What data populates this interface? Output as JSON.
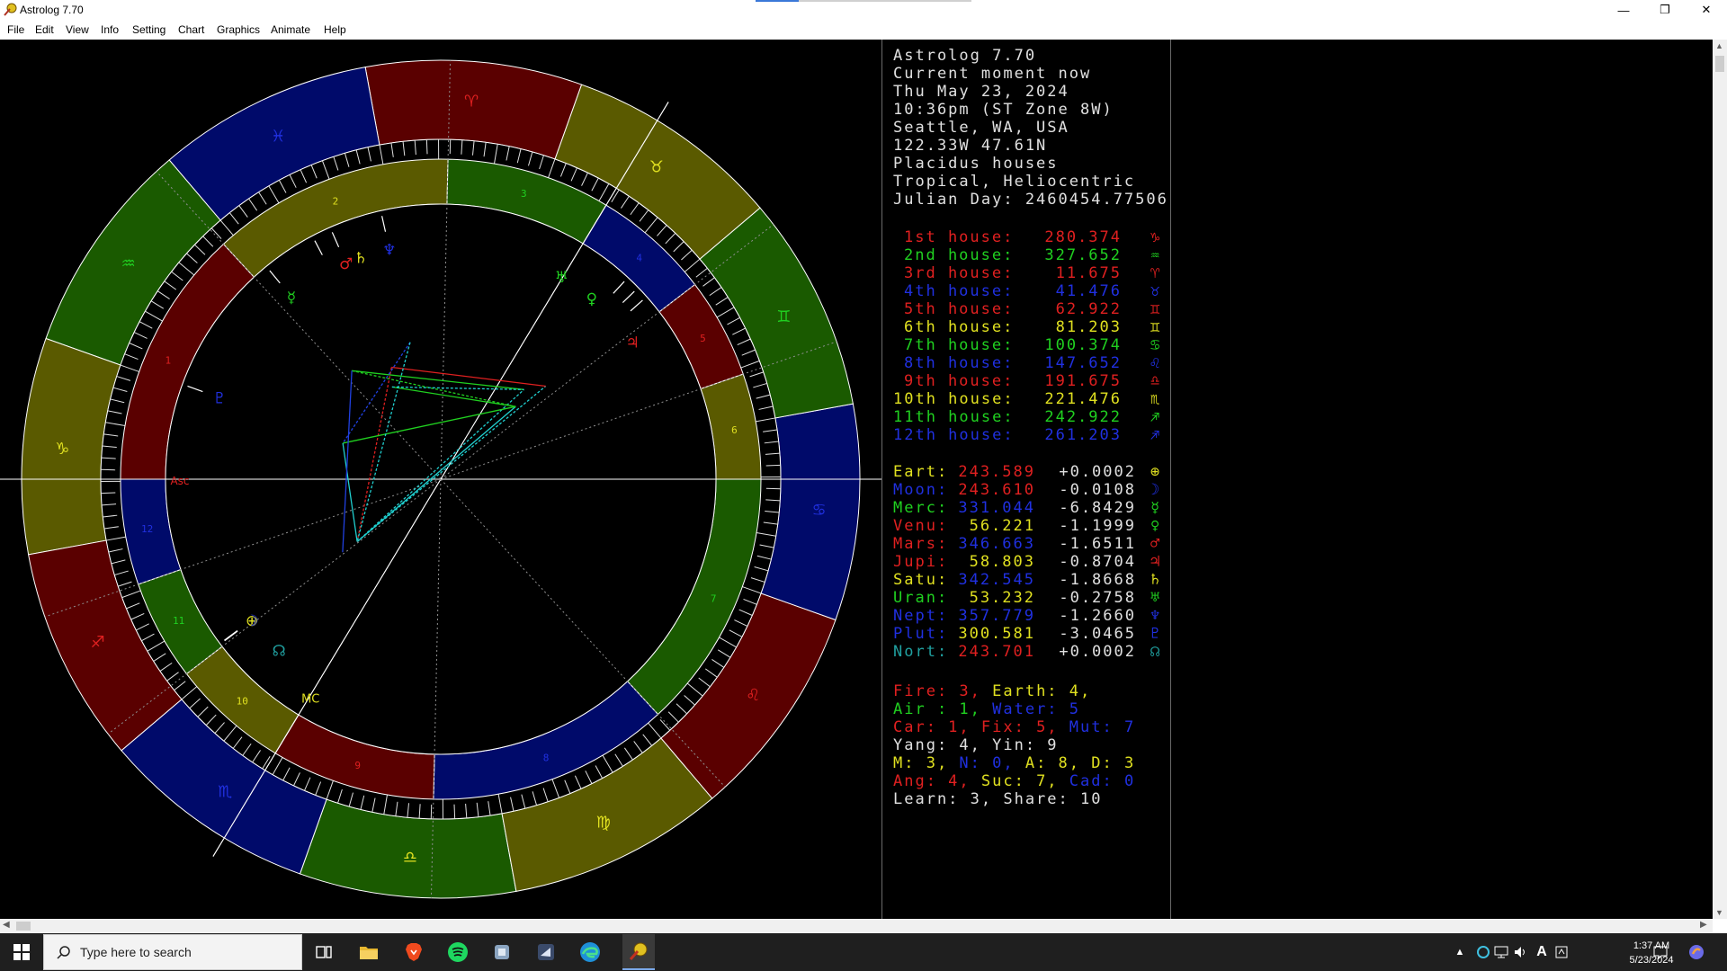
{
  "window": {
    "title": "Astrolog 7.70"
  },
  "menu": [
    "File",
    "Edit",
    "View",
    "Info",
    "Setting",
    "Chart",
    "Graphics",
    "Animate",
    "Help"
  ],
  "info": {
    "lines": [
      "Astrolog 7.70",
      "Current moment now",
      "Thu May 23, 2024",
      "10:36pm (ST Zone 8W)",
      "Seattle, WA, USA",
      "122.33W 47.61N",
      "Placidus houses",
      "Tropical, Heliocentric",
      "Julian Day: 2460454.77506"
    ],
    "color": "#e0e0e0"
  },
  "houses": [
    {
      "label": "1st house:",
      "value": "280.374",
      "color": "#e02020",
      "sym": "♑"
    },
    {
      "label": "2nd house:",
      "value": "327.652",
      "color": "#20d020",
      "sym": "♒"
    },
    {
      "label": "3rd house:",
      "value": "11.675",
      "color": "#e02020",
      "sym": "♈"
    },
    {
      "label": "4th house:",
      "value": "41.476",
      "color": "#2030e0",
      "sym": "♉"
    },
    {
      "label": "5th house:",
      "value": "62.922",
      "color": "#e02020",
      "sym": "♊"
    },
    {
      "label": "6th house:",
      "value": "81.203",
      "color": "#e0e020",
      "sym": "♊"
    },
    {
      "label": "7th house:",
      "value": "100.374",
      "color": "#20d020",
      "sym": "♋"
    },
    {
      "label": "8th house:",
      "value": "147.652",
      "color": "#2030e0",
      "sym": "♌"
    },
    {
      "label": "9th house:",
      "value": "191.675",
      "color": "#e02020",
      "sym": "♎"
    },
    {
      "label": "10th house:",
      "value": "221.476",
      "color": "#e0e020",
      "sym": "♏"
    },
    {
      "label": "11th house:",
      "value": "242.922",
      "color": "#20d020",
      "sym": "♐"
    },
    {
      "label": "12th house:",
      "value": "261.203",
      "color": "#2030e0",
      "sym": "♐"
    }
  ],
  "planets": [
    {
      "name": "Eart:",
      "lon": "243.589",
      "lon_color": "#e02020",
      "speed": "+0.0002",
      "name_color": "#e0e020",
      "sym": "⊕",
      "sym_color": "#e0e020"
    },
    {
      "name": "Moon:",
      "lon": "243.610",
      "lon_color": "#e02020",
      "speed": "-0.0108",
      "name_color": "#2030e0",
      "sym": "☽",
      "sym_color": "#2030e0"
    },
    {
      "name": "Merc:",
      "lon": "331.044",
      "lon_color": "#2030e0",
      "speed": "-6.8429",
      "name_color": "#20d020",
      "sym": "☿",
      "sym_color": "#20d020"
    },
    {
      "name": "Venu:",
      "lon": "56.221",
      "lon_color": "#e0e020",
      "speed": "-1.1999",
      "name_color": "#e02020",
      "sym": "♀",
      "sym_color": "#20d020"
    },
    {
      "name": "Mars:",
      "lon": "346.663",
      "lon_color": "#2030e0",
      "speed": "-1.6511",
      "name_color": "#e02020",
      "sym": "♂",
      "sym_color": "#e02020"
    },
    {
      "name": "Jupi:",
      "lon": "58.803",
      "lon_color": "#e0e020",
      "speed": "-0.8704",
      "name_color": "#e02020",
      "sym": "♃",
      "sym_color": "#e02020"
    },
    {
      "name": "Satu:",
      "lon": "342.545",
      "lon_color": "#2030e0",
      "speed": "-1.8668",
      "name_color": "#e0e020",
      "sym": "♄",
      "sym_color": "#e0e020"
    },
    {
      "name": "Uran:",
      "lon": "53.232",
      "lon_color": "#e0e020",
      "speed": "-0.2758",
      "name_color": "#20d020",
      "sym": "♅",
      "sym_color": "#20d020"
    },
    {
      "name": "Nept:",
      "lon": "357.779",
      "lon_color": "#2030e0",
      "speed": "-1.2660",
      "name_color": "#2030e0",
      "sym": "♆",
      "sym_color": "#2030e0"
    },
    {
      "name": "Plut:",
      "lon": "300.581",
      "lon_color": "#e0e020",
      "speed": "-3.0465",
      "name_color": "#2030e0",
      "sym": "♇",
      "sym_color": "#2030e0"
    },
    {
      "name": "Nort:",
      "lon": "243.701",
      "lon_color": "#e02020",
      "speed": "+0.0002",
      "name_color": "#20a0a0",
      "sym": "☊",
      "sym_color": "#20a0a0"
    }
  ],
  "stats": [
    [
      {
        "t": "Fire: 3, ",
        "c": "#e02020"
      },
      {
        "t": "Earth: 4,",
        "c": "#e0e020"
      }
    ],
    [
      {
        "t": "Air : 1, ",
        "c": "#20d020"
      },
      {
        "t": "Water: 5",
        "c": "#2030e0"
      }
    ],
    [
      {
        "t": "Car: 1, ",
        "c": "#e02020"
      },
      {
        "t": "Fix: 5, ",
        "c": "#e02020"
      },
      {
        "t": "Mut: 7",
        "c": "#2030e0"
      }
    ],
    [
      {
        "t": "Yang: 4, Yin: 9",
        "c": "#e0e0e0"
      }
    ],
    [
      {
        "t": "M: 3, ",
        "c": "#e0e020"
      },
      {
        "t": "N: 0, ",
        "c": "#2030e0"
      },
      {
        "t": "A: 8, ",
        "c": "#e0e020"
      },
      {
        "t": "D: 3",
        "c": "#e0e020"
      }
    ],
    [
      {
        "t": "Ang: 4, ",
        "c": "#e02020"
      },
      {
        "t": "Suc: 7, ",
        "c": "#e0e020"
      },
      {
        "t": "Cad: 0",
        "c": "#2030e0"
      }
    ],
    [
      {
        "t": "Learn: 3, Share: 10",
        "c": "#e0e0e0"
      }
    ]
  ],
  "wheel": {
    "signs": [
      {
        "sym": "♎",
        "color": "#1a5a00",
        "text_color": "#e0e020"
      },
      {
        "sym": "♍",
        "color": "#5a5a00",
        "text_color": "#e0e020"
      },
      {
        "sym": "♌",
        "color": "#5a0000",
        "text_color": "#e02020"
      },
      {
        "sym": "♋",
        "color": "#000a6a",
        "text_color": "#2030e0"
      },
      {
        "sym": "♊",
        "color": "#1a5a00",
        "text_color": "#20d020"
      },
      {
        "sym": "♉",
        "color": "#5a5a00",
        "text_color": "#e0e020"
      },
      {
        "sym": "♈",
        "color": "#5a0000",
        "text_color": "#e02020"
      },
      {
        "sym": "♓",
        "color": "#000a6a",
        "text_color": "#2030e0"
      },
      {
        "sym": "♒",
        "color": "#1a5a00",
        "text_color": "#20d020"
      },
      {
        "sym": "♑",
        "color": "#5a5a00",
        "text_color": "#e0e020"
      },
      {
        "sym": "♐",
        "color": "#5a0000",
        "text_color": "#e02020"
      },
      {
        "sym": "♏",
        "color": "#000a6a",
        "text_color": "#2030e0"
      }
    ],
    "houses": [
      {
        "num": "1",
        "color": "#5a0000",
        "text_color": "#e02020"
      },
      {
        "num": "2",
        "color": "#5a5a00",
        "text_color": "#e0e020"
      },
      {
        "num": "3",
        "color": "#1a5a00",
        "text_color": "#20d020"
      },
      {
        "num": "4",
        "color": "#000a6a",
        "text_color": "#2030e0"
      },
      {
        "num": "5",
        "color": "#5a0000",
        "text_color": "#e02020"
      },
      {
        "num": "6",
        "color": "#5a5a00",
        "text_color": "#e0e020"
      },
      {
        "num": "7",
        "color": "#1a5a00",
        "text_color": "#20d020"
      },
      {
        "num": "8",
        "color": "#000a6a",
        "text_color": "#2030e0"
      },
      {
        "num": "9",
        "color": "#5a0000",
        "text_color": "#e02020"
      },
      {
        "num": "10",
        "color": "#5a5a00",
        "text_color": "#e0e020"
      },
      {
        "num": "11",
        "color": "#1a5a00",
        "text_color": "#20d020"
      },
      {
        "num": "12",
        "color": "#000a6a",
        "text_color": "#2030e0"
      }
    ],
    "asc_label": "Asc",
    "mc_label": "MC"
  },
  "taskbar": {
    "search_placeholder": "Type here to search",
    "time": "1:37 AM",
    "date": "5/23/2024"
  }
}
